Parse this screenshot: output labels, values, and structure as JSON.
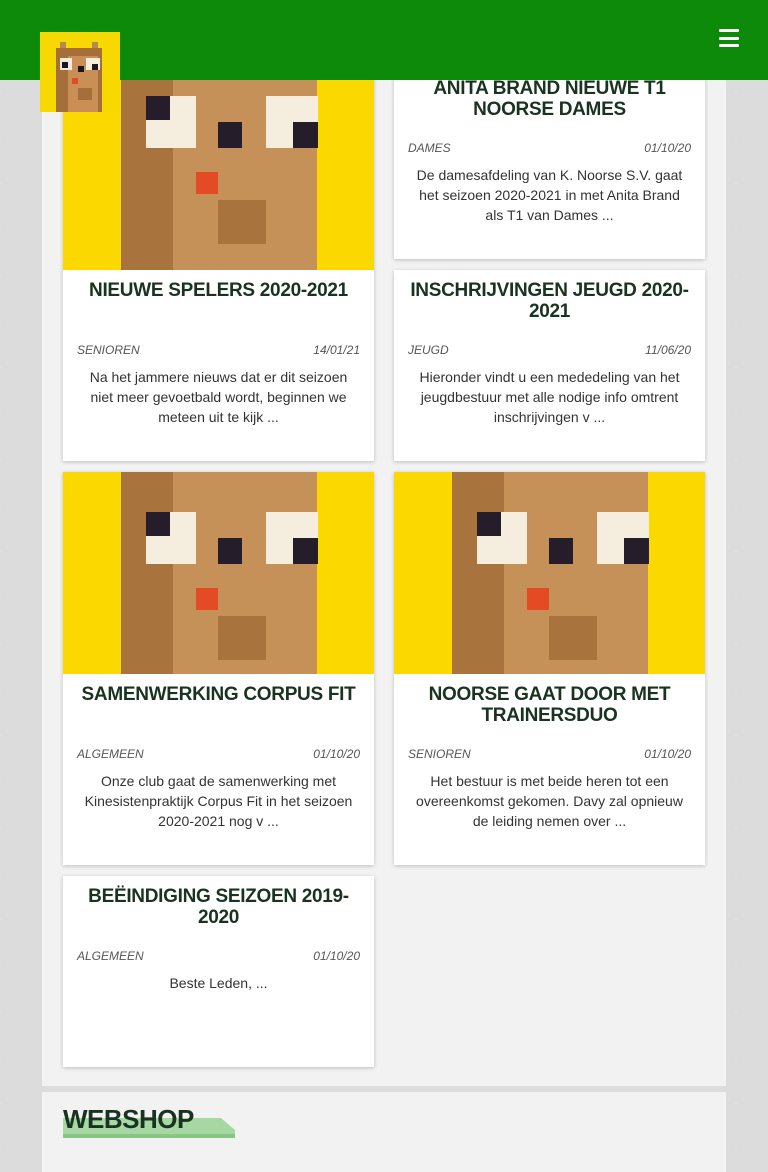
{
  "site": {
    "brand_colors": {
      "header_green": "#0d8a0a",
      "logo_yellow": "#f7d800",
      "title_dark": "#1a3320"
    }
  },
  "header": {
    "menu_icon": "hamburger-menu-icon",
    "logo_icon": "club-mascot-logo"
  },
  "articles": [
    {
      "title": "ANITA BRAND NIEUWE T1 NOORSE DAMES",
      "category": "DAMES",
      "date": "01/10/20",
      "excerpt": "De damesafdeling van K. Noorse S.V. gaat het seizoen 2020-2021 in met Anita Brand als T1 van Dames ..."
    },
    {
      "title": "NIEUWE SPELERS 2020-2021",
      "category": "SENIOREN",
      "date": "14/01/21",
      "excerpt": "Na het jammere nieuws dat er dit seizoen niet meer gevoetbald wordt, beginnen we meteen uit te kijk ..."
    },
    {
      "title": "INSCHRIJVINGEN JEUGD 2020-2021",
      "category": "JEUGD",
      "date": "11/06/20",
      "excerpt": "Hieronder vindt u een mededeling van het jeugdbestuur met alle nodige info omtrent inschrijvingen v ..."
    },
    {
      "title": "SAMENWERKING CORPUS FIT",
      "category": "ALGEMEEN",
      "date": "01/10/20",
      "excerpt": "Onze club gaat de samenwerking met Kinesistenpraktijk Corpus Fit in het seizoen 2020-2021 nog v ..."
    },
    {
      "title": "NOORSE GAAT DOOR MET TRAINERSDUO",
      "category": "SENIOREN",
      "date": "01/10/20",
      "excerpt": "Het bestuur is met beide heren tot een overeenkomst gekomen. Davy zal opnieuw de leiding nemen over ..."
    },
    {
      "title": "BEËINDIGING SEIZOEN 2019-2020",
      "category": "ALGEMEEN",
      "date": "01/10/20",
      "excerpt": "Beste Leden,   ..."
    }
  ],
  "webshop": {
    "title": "WEBSHOP"
  }
}
